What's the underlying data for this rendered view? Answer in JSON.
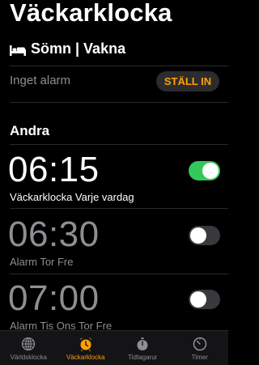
{
  "header": {
    "title": "Väckarklocka"
  },
  "sleep": {
    "label": "Sömn | Vakna",
    "icon": "bed-icon"
  },
  "no_alarm": {
    "text": "Inget alarm",
    "button": "STÄLL IN"
  },
  "section": {
    "title": "Andra"
  },
  "alarms": [
    {
      "time": "06:15",
      "label": "Väckarklocka  Varje vardag",
      "enabled": true
    },
    {
      "time": "06:30",
      "label": "Alarm Tor Fre",
      "enabled": false
    },
    {
      "time": "07:00",
      "label": "Alarm Tis Ons Tor Fre",
      "enabled": false
    }
  ],
  "tabs": [
    {
      "label": "Världsklocka",
      "icon": "globe-icon",
      "active": false
    },
    {
      "label": "Väckarklocka",
      "icon": "alarm-clock-icon",
      "active": true
    },
    {
      "label": "Tidtagarur",
      "icon": "stopwatch-icon",
      "active": false
    },
    {
      "label": "Timer",
      "icon": "timer-icon",
      "active": false
    }
  ],
  "colors": {
    "accent": "#ff9f0a",
    "toggle_on": "#34c759",
    "background": "#000000"
  }
}
